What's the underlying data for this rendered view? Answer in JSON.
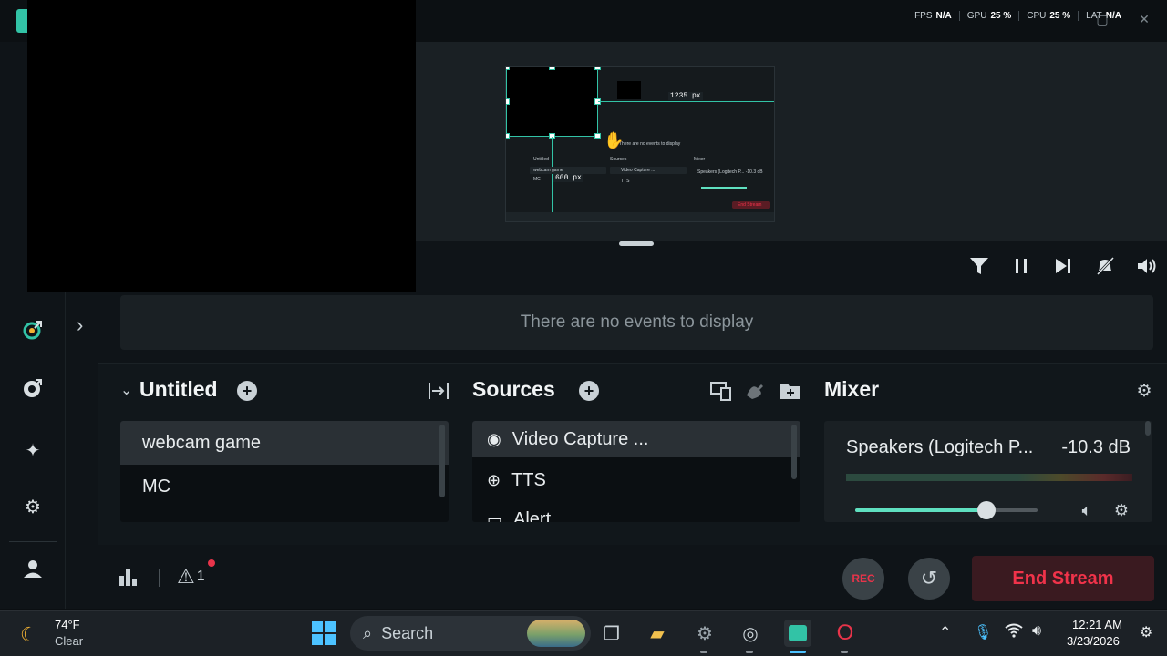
{
  "perf": [
    {
      "label": "FPS",
      "value": "N/A"
    },
    {
      "label": "GPU",
      "value": "25 %"
    },
    {
      "label": "CPU",
      "value": "25 %"
    },
    {
      "label": "LAT",
      "value": "N/A"
    }
  ],
  "preview": {
    "width_label": "1235 px",
    "height_label": "600 px",
    "inner_events_text": "There are no events to display",
    "inner_scenes_title": "Untitled",
    "inner_sources_title": "Sources",
    "inner_mixer_title": "Mixer",
    "inner_scene_items": [
      "webcam game",
      "MC"
    ],
    "inner_source_items": [
      "Video Capture ...",
      "TTS"
    ],
    "inner_mixer_text": "Speakers (Logitech P... -10.3 dB",
    "inner_end_stream": "End Stream"
  },
  "events": {
    "empty_text": "There are no events to display"
  },
  "scenes": {
    "title": "Untitled",
    "items": [
      {
        "label": "webcam game",
        "active": true
      },
      {
        "label": "MC",
        "active": false
      }
    ]
  },
  "sources": {
    "title": "Sources",
    "items": [
      {
        "label": "Video Capture ...",
        "icon": "webcam-icon",
        "active": true
      },
      {
        "label": "TTS",
        "icon": "globe-icon",
        "active": false
      },
      {
        "label": "Alert",
        "icon": "browser-icon",
        "active": false
      }
    ]
  },
  "mixer": {
    "title": "Mixer",
    "device": "Speakers (Logitech P...",
    "level": "-10.3 dB",
    "volume": 0.72
  },
  "footer": {
    "alert_count": "1",
    "rec_label": "REC",
    "end_stream_label": "End Stream"
  },
  "taskbar": {
    "weather_temp": "74°F",
    "weather_cond": "Clear",
    "search_placeholder": "Search",
    "time": "12:21 AM",
    "date": "3/23/2026"
  },
  "colors": {
    "accent": "#32c3a6",
    "end_stream": "#f0334a",
    "rec": "#e8344a"
  }
}
